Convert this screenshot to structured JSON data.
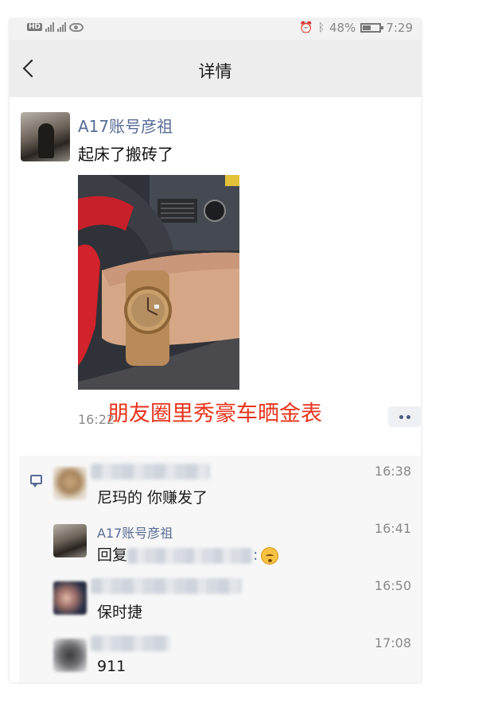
{
  "status_bar": {
    "left_label": "HD",
    "battery": "48%",
    "time": "7:29"
  },
  "header": {
    "title": "详情"
  },
  "post": {
    "author": "A17账号彦祖",
    "text": "起床了搬砖了",
    "time": "16:22",
    "annotation": "朋友圈里秀豪车晒金表"
  },
  "comments": [
    {
      "name": "",
      "time": "16:38",
      "text": "尼玛的  你赚发了"
    },
    {
      "name": "A17账号彦祖",
      "time": "16:41",
      "reply_prefix": "回复",
      "reply_colon": ":"
    },
    {
      "name": "",
      "time": "16:50",
      "text": "保时捷"
    },
    {
      "name": "",
      "time": "17:08",
      "text": "911"
    }
  ],
  "colors": {
    "link_name": "#576b95",
    "annotation": "#e8341c"
  }
}
